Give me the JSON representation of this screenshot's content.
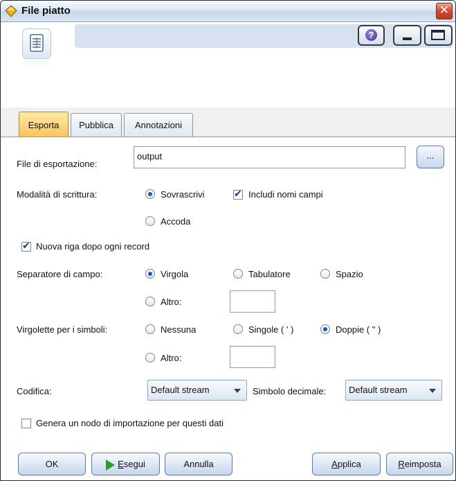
{
  "window": {
    "title": "File piatto"
  },
  "tabs": [
    {
      "label": "Esporta",
      "active": true
    },
    {
      "label": "Pubblica",
      "active": false
    },
    {
      "label": "Annotazioni",
      "active": false
    }
  ],
  "export": {
    "file_label": "File di esportazione:",
    "file_value": "output",
    "browse_label": "...",
    "write_mode_label": "Modalità di scrittura:",
    "write_overwrite": "Sovrascrivi",
    "write_append": "Accoda",
    "include_field_names": "Includi nomi campi",
    "newline_after_record": "Nuova riga dopo ogni record",
    "field_separator_label": "Separatore di campo:",
    "sep_comma": "Virgola",
    "sep_tab": "Tabulatore",
    "sep_space": "Spazio",
    "sep_other": "Altro:",
    "quotes_label": "Virgolette per i simboli:",
    "quote_none": "Nessuna",
    "quote_single": "Singole ( ' )",
    "quote_double": "Doppie ( \" )",
    "quote_other": "Altro:",
    "encoding_label": "Codifica:",
    "encoding_value": "Default stream",
    "decimal_symbol_label": "Simbolo decimale:",
    "decimal_symbol_value": "Default stream",
    "generate_import_node": "Genera un nodo di importazione per questi dati"
  },
  "buttons": {
    "ok": "OK",
    "run_prefix": "",
    "run_underlined": "E",
    "run_rest": "segui",
    "cancel": "Annulla",
    "apply_underlined": "A",
    "apply_rest": "pplica",
    "reset_underlined": "R",
    "reset_rest": "eimposta"
  },
  "icons": [
    "diamond-node-icon",
    "close-icon",
    "file-node-icon",
    "help-icon",
    "minimize-icon",
    "maximize-icon",
    "play-icon",
    "dropdown-caret-icon"
  ],
  "colors": {
    "active_tab": "#fbc55b",
    "title_bar": "#dbe6f3",
    "run_icon": "#2e9b2e"
  }
}
